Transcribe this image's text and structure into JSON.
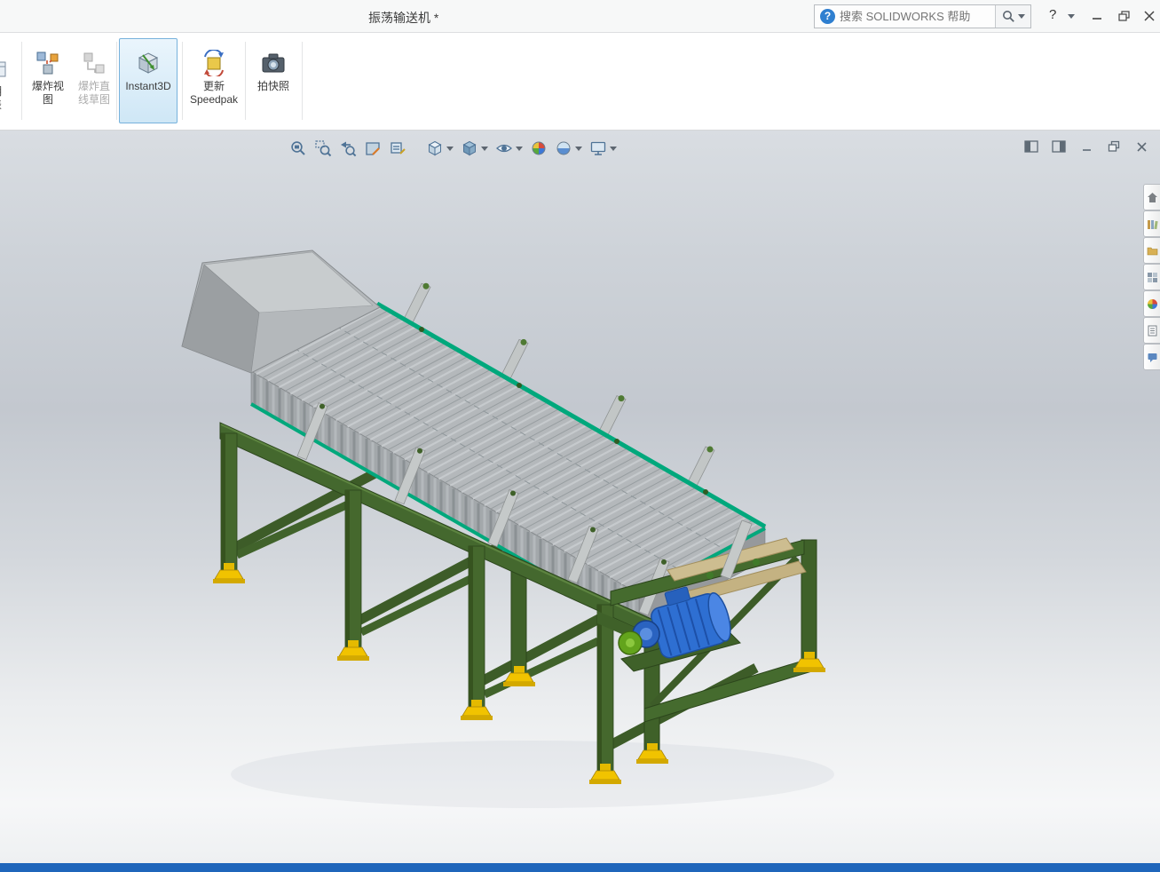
{
  "window": {
    "title": "振荡输送机 *",
    "controls": {
      "help": "?"
    }
  },
  "search": {
    "placeholder": "搜索 SOLIDWORKS 帮助",
    "badge": "?"
  },
  "ribbon": {
    "partial": {
      "line1": "明",
      "line2": "表"
    },
    "exploded_view": {
      "line1": "爆炸视",
      "line2": "图"
    },
    "explode_line_sketch": {
      "line1": "爆炸直",
      "line2": "线草图"
    },
    "instant3d": {
      "label": "Instant3D"
    },
    "update_speedpak": {
      "line1": "更新",
      "line2": "Speedpak"
    },
    "take_snapshot": {
      "label": "拍快照"
    }
  },
  "heads_up_items": [
    "zoom-to-fit",
    "zoom-to-area",
    "previous-view",
    "section-view",
    "annotation-views",
    "view-orientation",
    "display-style",
    "hide-show-items",
    "edit-appearance",
    "apply-scene",
    "view-settings"
  ],
  "document_controls": [
    "pane-left",
    "pane-right",
    "minimize",
    "restore",
    "close"
  ],
  "task_pane_tabs": [
    "home",
    "design-library",
    "file-explorer",
    "view-palette",
    "appearances",
    "custom-properties",
    "forum"
  ],
  "colors": {
    "status_bar": "#1f66bb",
    "instant3d_active_border": "#77b2dc",
    "teal_rim": "#00a87c",
    "frame_green": "#44682e",
    "feet_yellow": "#f1c300",
    "motor_blue": "#2e6fd2"
  }
}
